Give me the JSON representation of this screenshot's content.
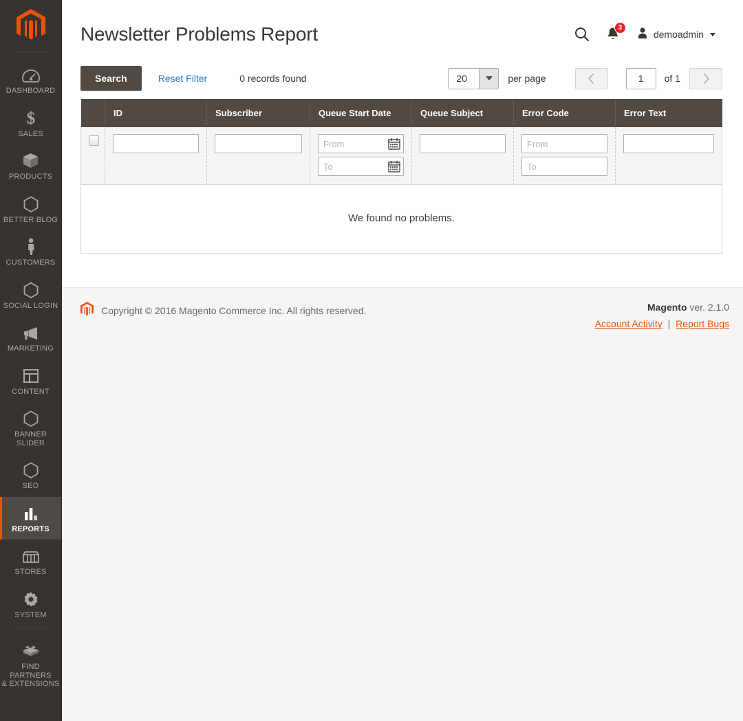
{
  "sidebar": {
    "logo_name": "magento-logo",
    "items": [
      {
        "label": "DASHBOARD",
        "icon": "dashboard-gauge-icon",
        "active": false
      },
      {
        "label": "SALES",
        "icon": "dollar-sign-icon",
        "active": false
      },
      {
        "label": "PRODUCTS",
        "icon": "box-icon",
        "active": false
      },
      {
        "label": "BETTER BLOG",
        "icon": "hexagon-icon",
        "active": false
      },
      {
        "label": "CUSTOMERS",
        "icon": "person-icon",
        "active": false
      },
      {
        "label": "SOCIAL LOGIN",
        "icon": "hexagon-icon",
        "active": false
      },
      {
        "label": "MARKETING",
        "icon": "megaphone-icon",
        "active": false
      },
      {
        "label": "CONTENT",
        "icon": "layout-panel-icon",
        "active": false
      },
      {
        "label": "BANNER SLIDER",
        "icon": "hexagon-icon",
        "active": false
      },
      {
        "label": "SEO",
        "icon": "hexagon-icon",
        "active": false
      },
      {
        "label": "REPORTS",
        "icon": "bar-chart-icon",
        "active": true
      },
      {
        "label": "STORES",
        "icon": "storefront-icon",
        "active": false
      },
      {
        "label": "SYSTEM",
        "icon": "gear-icon",
        "active": false
      },
      {
        "label": "FIND PARTNERS\n& EXTENSIONS",
        "icon": "lego-brick-icon",
        "active": false
      }
    ]
  },
  "header": {
    "title": "Newsletter Problems Report",
    "search_icon": "search-icon",
    "notifications_icon": "bell-icon",
    "notifications_count": "3",
    "user_icon": "user-avatar-icon",
    "user_name": "demoadmin"
  },
  "toolbar": {
    "search_label": "Search",
    "reset_filter_label": "Reset Filter",
    "records_found": "0 records found",
    "per_page_value": "20",
    "per_page_label": "per page",
    "prev_icon": "chevron-left-icon",
    "next_icon": "chevron-right-icon",
    "page_value": "1",
    "of_pages": "of 1"
  },
  "grid": {
    "columns": [
      {
        "key": "checkbox",
        "label": ""
      },
      {
        "key": "id",
        "label": "ID"
      },
      {
        "key": "subscriber",
        "label": "Subscriber"
      },
      {
        "key": "queue_start_date",
        "label": "Queue Start Date"
      },
      {
        "key": "queue_subject",
        "label": "Queue Subject"
      },
      {
        "key": "error_code",
        "label": "Error Code"
      },
      {
        "key": "error_text",
        "label": "Error Text"
      }
    ],
    "filters": {
      "id_value": "",
      "subscriber_value": "",
      "queue_start_from_placeholder": "From",
      "queue_start_to_placeholder": "To",
      "queue_subject_value": "",
      "error_code_from_placeholder": "From",
      "error_code_to_placeholder": "To",
      "error_text_value": ""
    },
    "empty_message": "We found no problems."
  },
  "footer": {
    "logo_name": "magento-footer-logo",
    "copyright": "Copyright © 2016 Magento Commerce Inc. All rights reserved.",
    "brand": "Magento",
    "version": "ver. 2.1.0",
    "account_activity_label": "Account Activity",
    "link_separator": "|",
    "report_bugs_label": "Report Bugs"
  },
  "colors": {
    "accent_orange": "#eb5202",
    "sidebar_bg": "#373330",
    "header_dark": "#514943",
    "link_blue": "#2a7cc7",
    "badge_red": "#e22626"
  }
}
